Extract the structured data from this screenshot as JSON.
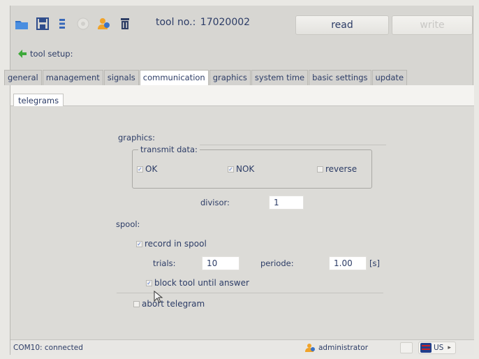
{
  "toolbar": {
    "icons": [
      "folder-icon",
      "save-icon",
      "list-icon",
      "disc-icon",
      "user-icon",
      "trash-icon"
    ],
    "tool_no_label": "tool no.:",
    "tool_no_value": "17020002",
    "read_label": "read",
    "write_label": "write",
    "setup_label": "tool setup:"
  },
  "tabs": [
    "general",
    "management",
    "signals",
    "communication",
    "graphics",
    "system time",
    "basic settings",
    "update"
  ],
  "active_tab": "communication",
  "subtab": "telegrams",
  "graphics": {
    "label": "graphics:",
    "transmit_label": "transmit data:",
    "ok_label": "OK",
    "ok_checked": true,
    "nok_label": "NOK",
    "nok_checked": true,
    "reverse_label": "reverse",
    "reverse_checked": false,
    "divisor_label": "divisor:",
    "divisor_value": "1"
  },
  "spool": {
    "label": "spool:",
    "record_label": "record in spool",
    "record_checked": true,
    "trials_label": "trials:",
    "trials_value": "10",
    "periode_label": "periode:",
    "periode_value": "1.00",
    "periode_unit": "[s]",
    "block_label": "block tool until answer",
    "block_checked": true
  },
  "abort_label": "abort telegram",
  "abort_checked": false,
  "status": {
    "connection": "COM10: connected",
    "user": "administrator",
    "language": "US"
  },
  "colors": {
    "text": "#2c3c66",
    "accent_orange": "#f0a32a",
    "checkbox_blue": "#4a6fd0"
  }
}
